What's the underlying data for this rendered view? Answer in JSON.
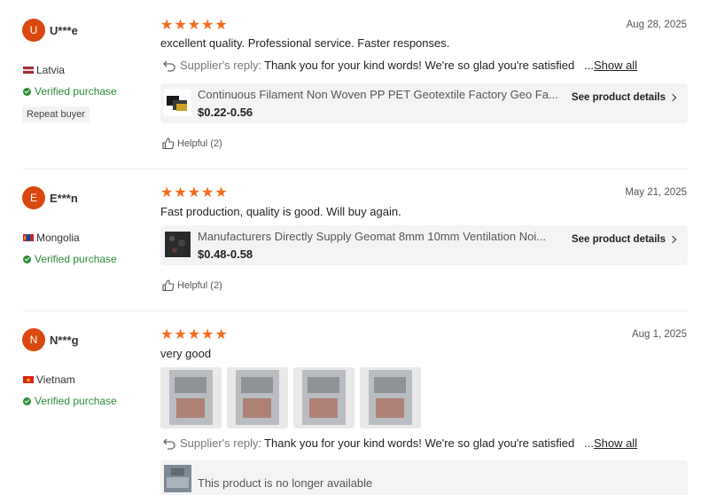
{
  "reviews": [
    {
      "avatar": "U",
      "name": "U***e",
      "country": "Latvia",
      "verified": "Verified purchase",
      "repeat": "Repeat buyer",
      "rating": 5,
      "date": "Aug 28, 2025",
      "comment": "excellent quality. Professional service. Faster responses.",
      "reply_label": "Supplier's reply:",
      "reply_text": "Thank you for your kind words! We're so glad you're satisfied",
      "reply_more": "...",
      "show_all": "Show all",
      "product_title": "Continuous Filament Non Woven PP PET Geotextile Factory Geo Fa...",
      "product_price": "$0.22-0.56",
      "product_details": "See product details",
      "helpful": "Helpful (2)"
    },
    {
      "avatar": "E",
      "name": "E***n",
      "country": "Mongolia",
      "verified": "Verified purchase",
      "rating": 5,
      "date": "May 21, 2025",
      "comment": "Fast production, quality is good. Will buy again.",
      "product_title": "Manufacturers Directly Supply Geomat 8mm 10mm Ventilation Noi...",
      "product_price": "$0.48-0.58",
      "product_details": "See product details",
      "helpful": "Helpful (2)"
    },
    {
      "avatar": "N",
      "name": "N***g",
      "country": "Vietnam",
      "verified": "Verified purchase",
      "rating": 5,
      "date": "Aug 1, 2025",
      "comment": "very good",
      "photo_count": 4,
      "reply_label": "Supplier's reply:",
      "reply_text": "Thank you for your kind words! We're so glad you're satisfied",
      "reply_more": "...",
      "show_all": "Show all",
      "unavailable": "This product is no longer available"
    }
  ],
  "icons": {
    "star": "star-icon",
    "verified": "check-circle-icon",
    "reply": "reply-arrow-icon",
    "helpful": "thumbs-up-icon",
    "chevron": "chevron-right-icon"
  },
  "colors": {
    "star": "#f26b1d",
    "verified": "#2e8b3a",
    "avatar": "#d9480f"
  }
}
